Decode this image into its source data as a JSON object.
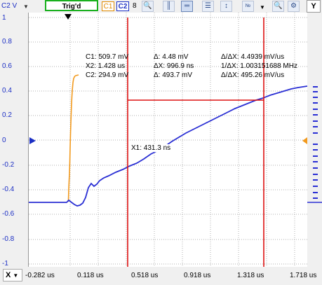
{
  "toolbar": {
    "y_unit_label": "C2 V",
    "trigger_status": "Trig'd",
    "channel1_button": "C1",
    "channel2_button": "C2",
    "acquisition_count": "8",
    "y_axis_button": "Y"
  },
  "y_axis": {
    "ticks": [
      "1",
      "0.8",
      "0.6",
      "0.4",
      "0.2",
      "0",
      "-0.2",
      "-0.4",
      "-0.6",
      "-0.8",
      "-1"
    ]
  },
  "x_axis": {
    "button_label": "X",
    "ticks": [
      "-0.282 us",
      "0.118 us",
      "0.518 us",
      "0.918 us",
      "1.318 us",
      "1.718 us"
    ]
  },
  "cursors": {
    "c1": "C1: 509.7 mV",
    "x2": "X2: 1.428 us",
    "c2": "C2: 294.9 mV",
    "delta1": "Δ: 4.48 mV",
    "delta_x": "ΔX: 996.9 ns",
    "delta2": "Δ: 493.7 mV",
    "rate1": "Δ/ΔX: 4.4939 mV/us",
    "freq": "1/ΔX: 1.003151688 MHz",
    "rate2": "Δ/ΔX: 495.26 mV/us",
    "x1": "X1: 431.3 ns"
  },
  "colors": {
    "channel1": "#f29a1e",
    "channel2": "#2a2fd4",
    "cursor": "#dd1111",
    "trigger_frame": "#19b01e"
  }
}
